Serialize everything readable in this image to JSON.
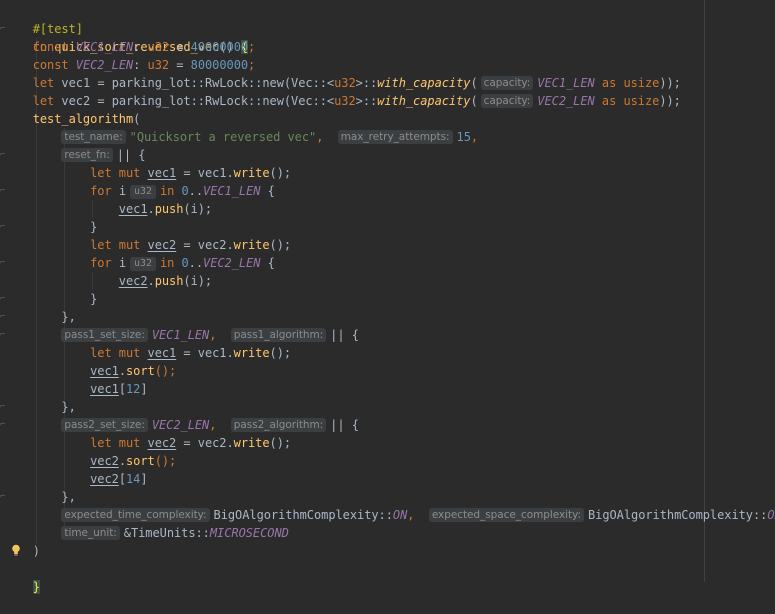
{
  "editor": {
    "l1": {
      "attr": "#[test]"
    },
    "l2": {
      "kw": "fn",
      "name": "quick_sort_reversed_vec",
      "parens": "()",
      "brace": "{"
    },
    "l3": {
      "kw": "const",
      "name": "VEC1_LEN",
      "colon": ":",
      "ty": "u32",
      "eq": "=",
      "val": "40000000",
      "semi": ";"
    },
    "l4": {
      "kw": "const",
      "name": "VEC2_LEN",
      "colon": ":",
      "ty": "u32",
      "eq": "=",
      "val": "80000000",
      "semi": ";"
    },
    "l5": {
      "kw": "let",
      "var": "vec1",
      "eq": "=",
      "path": "parking_lot::RwLock::new(Vec::<",
      "ty": "u32",
      "path2": ">::",
      "meth": "with_capacity",
      "open": "(",
      "hint": "capacity:",
      "arg": "VEC1_LEN",
      "as": "as",
      "usize": "usize",
      "close": "));"
    },
    "l6": {
      "kw": "let",
      "var": "vec2",
      "eq": "=",
      "path": "parking_lot::RwLock::new(Vec::<",
      "ty": "u32",
      "path2": ">::",
      "meth": "with_capacity",
      "open": "(",
      "hint": "capacity:",
      "arg": "VEC2_LEN",
      "as": "as",
      "usize": "usize",
      "close": "));"
    },
    "l7": {
      "meth": "test_algorithm",
      "open": "("
    },
    "l8": {
      "hint1": "test_name:",
      "str": "\"Quicksort a reversed vec\"",
      "comma": ",",
      "hint2": "max_retry_attempts:",
      "num": "15",
      "comma2": ","
    },
    "l9": {
      "hint": "reset_fn:",
      "code": "|| {"
    },
    "l10": {
      "kw": "let mut",
      "var": "vec1",
      "eq": "= vec1.",
      "meth": "write",
      "tail": "();"
    },
    "l11": {
      "kw": "for",
      "var": "i",
      "hint": "u32",
      "in": "in",
      "zero": "0",
      "range": "..",
      "const": "VEC1_LEN",
      "brace": "{"
    },
    "l12": {
      "var": "vec1",
      "dot": ".",
      "meth": "push",
      "tail": "(i);"
    },
    "l13": {
      "brace": "}"
    },
    "l14": {
      "kw": "let mut",
      "var": "vec2",
      "eq": "= vec2.",
      "meth": "write",
      "tail": "();"
    },
    "l15": {
      "kw": "for",
      "var": "i",
      "hint": "u32",
      "in": "in",
      "zero": "0",
      "range": "..",
      "const": "VEC2_LEN",
      "brace": "{"
    },
    "l16": {
      "var": "vec2",
      "dot": ".",
      "meth": "push",
      "tail": "(i);"
    },
    "l17": {
      "brace": "}"
    },
    "l18": {
      "brace": "},"
    },
    "l19": {
      "hint1": "pass1_set_size:",
      "const": "VEC1_LEN",
      "comma": ",",
      "hint2": "pass1_algorithm:",
      "code": "|| {"
    },
    "l20": {
      "kw": "let mut",
      "var": "vec1",
      "eq": "= vec1.",
      "meth": "write",
      "tail": "();"
    },
    "l21": {
      "var": "vec1",
      "dot": ".",
      "meth": "sort",
      "tail": "();"
    },
    "l22": {
      "var": "vec1",
      "open": "[",
      "num": "12",
      "close": "]"
    },
    "l23": {
      "brace": "},"
    },
    "l24": {
      "hint1": "pass2_set_size:",
      "const": "VEC2_LEN",
      "comma": ",",
      "hint2": "pass2_algorithm:",
      "code": "|| {"
    },
    "l25": {
      "kw": "let mut",
      "var": "vec2",
      "eq": "= vec2.",
      "meth": "write",
      "tail": "();"
    },
    "l26": {
      "var": "vec2",
      "dot": ".",
      "meth": "sort",
      "tail": "();"
    },
    "l27": {
      "var": "vec2",
      "open": "[",
      "num": "14",
      "close": "]"
    },
    "l28": {
      "brace": "},"
    },
    "l29": {
      "hint1": "expected_time_complexity:",
      "path1": "BigOAlgorithmComplexity::",
      "c1": "ON",
      "comma": ",",
      "hint2": "expected_space_complexity:",
      "path2": "BigOAlgorithmComplexity::",
      "c2": "ON",
      "comma2": ","
    },
    "l30": {
      "hint": "time_unit:",
      "path": "&TimeUnits::",
      "const": "MICROSECOND"
    },
    "l31": {
      "close": ")"
    },
    "l32": {
      "brace": "}"
    }
  },
  "colors": {
    "background": "#2b2b2b",
    "keyword": "#cc7832",
    "function": "#ffc66d",
    "constant": "#9876aa",
    "number": "#6897bb",
    "string": "#6a8759",
    "attribute": "#bbb529",
    "text": "#a9b7c6",
    "hint_bg": "#3b3f41",
    "hint_fg": "#8c8c8c"
  }
}
